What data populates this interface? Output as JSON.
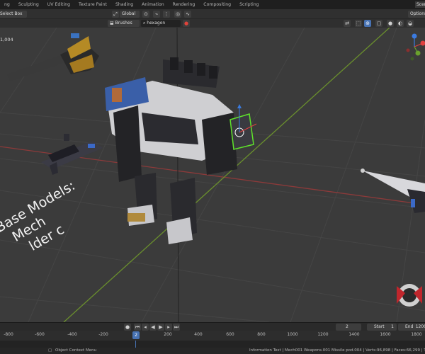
{
  "workspace_tabs": [
    "ng",
    "Sculpting",
    "UV Editing",
    "Texture Paint",
    "Shading",
    "Animation",
    "Rendering",
    "Compositing",
    "Scripting"
  ],
  "scene_label": "Scen",
  "header": {
    "select_mode": "Select Box",
    "transform_orientation": "Global",
    "options_label": "Options",
    "brushes_label": "Brushes",
    "brush_search": "hexagon"
  },
  "viewport": {
    "tool_label": "1,004",
    "onscreen_text": [
      "Base Models:",
      "Mech",
      "lder c"
    ]
  },
  "timeline": {
    "current_frame": "2",
    "start_label": "Start",
    "start_value": "1",
    "end_label": "End",
    "end_value": "1200",
    "ruler_ticks": [
      "-800",
      "-600",
      "-400",
      "-200",
      "2",
      "200",
      "400",
      "600",
      "800",
      "1000",
      "1200",
      "1400",
      "1600",
      "1800"
    ]
  },
  "status_bar": {
    "left": "Object Context Menu",
    "right": "Information Text | Mech001 Weapons.001 Missile pod.004 | Verts:96,898 | Faces:66,299 | Tris:67,6"
  },
  "colors": {
    "viewport_bg": "#3b3b3b",
    "grid": "#444444",
    "x_axis": "#8c3a3a",
    "y_axis": "#6a8f2d",
    "selection": "#5fe22b",
    "playhead": "#4772b3"
  }
}
